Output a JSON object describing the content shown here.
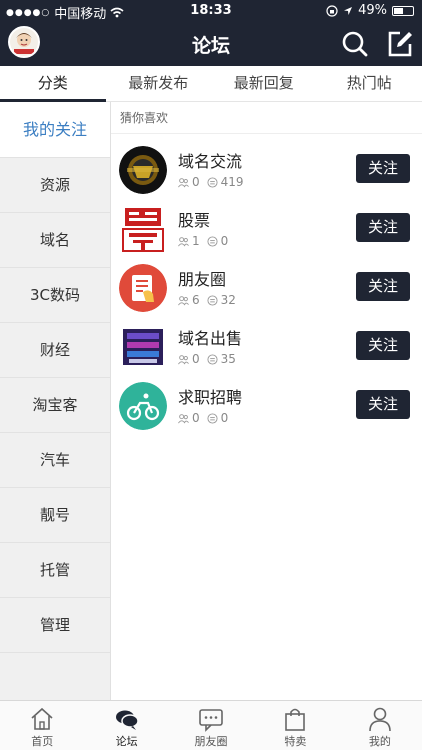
{
  "status_bar": {
    "carrier": "中国移动",
    "time": "18:33",
    "battery": "49%",
    "signal_dots": "●●●●○"
  },
  "navbar": {
    "title": "论坛",
    "icons": [
      "avatar",
      "search-icon",
      "compose-icon"
    ]
  },
  "tabs": [
    {
      "label": "分类",
      "active": true
    },
    {
      "label": "最新发布",
      "active": false
    },
    {
      "label": "最新回复",
      "active": false
    },
    {
      "label": "热门帖",
      "active": false
    }
  ],
  "sidebar": {
    "items": [
      {
        "label": "我的关注",
        "active": true
      },
      {
        "label": "资源"
      },
      {
        "label": "域名"
      },
      {
        "label": "3C数码"
      },
      {
        "label": "财经"
      },
      {
        "label": "淘宝客"
      },
      {
        "label": "汽车"
      },
      {
        "label": "靓号"
      },
      {
        "label": "托管"
      },
      {
        "label": "管理"
      }
    ]
  },
  "content": {
    "section_title": "猜你喜欢",
    "forums": [
      {
        "name": "域名交流",
        "members": "0",
        "posts": "419",
        "button": "关注"
      },
      {
        "name": "股票",
        "members": "1",
        "posts": "0",
        "button": "关注"
      },
      {
        "name": "朋友圈",
        "members": "6",
        "posts": "32",
        "button": "关注"
      },
      {
        "name": "域名出售",
        "members": "0",
        "posts": "35",
        "button": "关注"
      },
      {
        "name": "求职招聘",
        "members": "0",
        "posts": "0",
        "button": "关注"
      }
    ]
  },
  "bottom_nav": [
    {
      "label": "首页",
      "icon": "home-icon"
    },
    {
      "label": "论坛",
      "icon": "chat-bubbles-icon",
      "active": true
    },
    {
      "label": "朋友圈",
      "icon": "message-icon"
    },
    {
      "label": "特卖",
      "icon": "shopping-bag-icon"
    },
    {
      "label": "我的",
      "icon": "person-icon"
    }
  ],
  "colors": {
    "header_bg": "#1f2533",
    "active_sidebar_text": "#3b7ec2"
  }
}
